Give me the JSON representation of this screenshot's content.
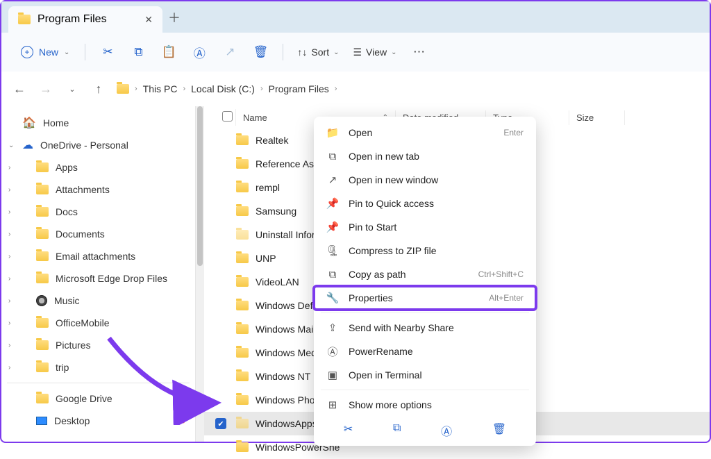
{
  "tab": {
    "title": "Program Files"
  },
  "toolbar": {
    "new_label": "New",
    "sort_label": "Sort",
    "view_label": "View"
  },
  "breadcrumb": [
    "This PC",
    "Local Disk (C:)",
    "Program Files"
  ],
  "sidebar": {
    "home_label": "Home",
    "onedrive_label": "OneDrive - Personal",
    "items": [
      "Apps",
      "Attachments",
      "Docs",
      "Documents",
      "Email attachments",
      "Microsoft Edge Drop Files",
      "Music",
      "OfficeMobile",
      "Pictures",
      "trip"
    ],
    "pinned": [
      "Google Drive",
      "Desktop"
    ]
  },
  "columns": {
    "name": "Name",
    "date": "Date modified",
    "type": "Type",
    "size": "Size"
  },
  "files": [
    "Realtek",
    "Reference Assemb",
    "rempl",
    "Samsung",
    "Uninstall Informati",
    "UNP",
    "VideoLAN",
    "Windows Defende",
    "Windows Mail",
    "Windows Media Pl",
    "Windows NT",
    "Windows Photo Vi",
    "WindowsApps",
    "WindowsPowerShe"
  ],
  "selected_index": 12,
  "dim_indexes": [
    4,
    12
  ],
  "context_menu": {
    "items": [
      {
        "icon": "folder",
        "label": "Open",
        "shortcut": "Enter"
      },
      {
        "icon": "newtab",
        "label": "Open in new tab"
      },
      {
        "icon": "external",
        "label": "Open in new window"
      },
      {
        "icon": "pin",
        "label": "Pin to Quick access"
      },
      {
        "icon": "pin",
        "label": "Pin to Start"
      },
      {
        "icon": "zip",
        "label": "Compress to ZIP file"
      },
      {
        "icon": "copy",
        "label": "Copy as path",
        "shortcut": "Ctrl+Shift+C"
      },
      {
        "icon": "wrench",
        "label": "Properties",
        "shortcut": "Alt+Enter",
        "highlight": true
      }
    ],
    "sep_after": 7,
    "extra": [
      {
        "icon": "share",
        "label": "Send with Nearby Share"
      },
      {
        "icon": "rename",
        "label": "PowerRename"
      },
      {
        "icon": "terminal",
        "label": "Open in Terminal"
      }
    ],
    "more_label": "Show more options"
  },
  "annotation": {
    "highlight_color": "#7c3aed"
  }
}
